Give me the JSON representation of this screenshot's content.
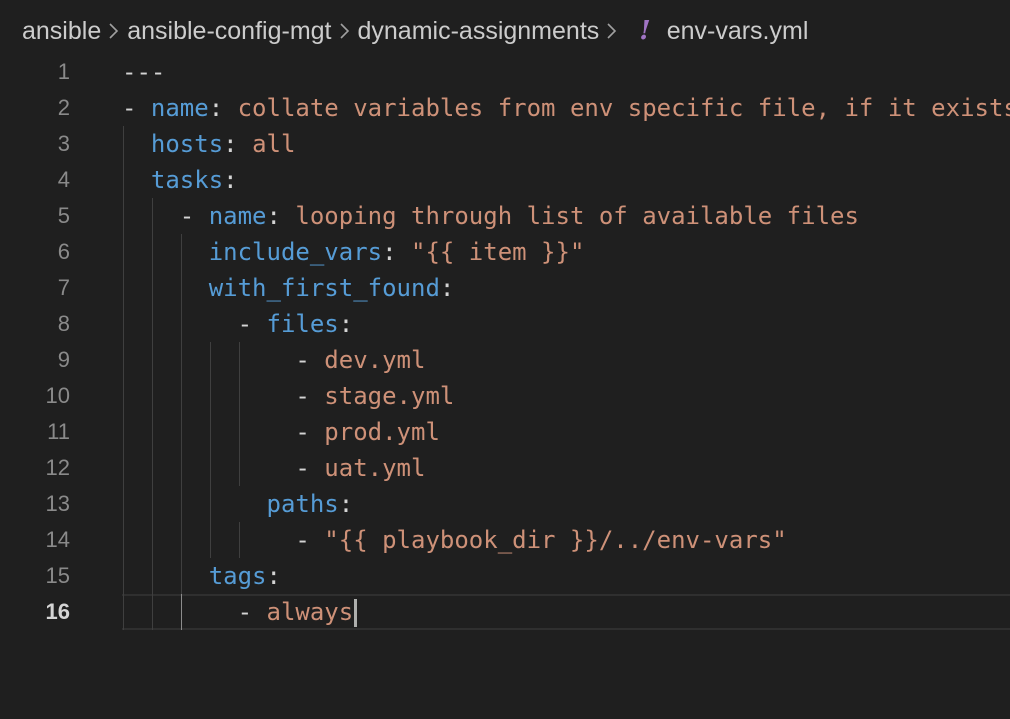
{
  "breadcrumb": {
    "items": [
      "ansible",
      "ansible-config-mgt",
      "dynamic-assignments"
    ],
    "file_icon": "!",
    "file_name": "env-vars.yml",
    "separator_icon": "chevron-right-icon"
  },
  "editor": {
    "current_line": 16,
    "lines": [
      {
        "number": "1",
        "parts": [
          [
            "---",
            "p"
          ]
        ]
      },
      {
        "number": "2",
        "parts": [
          [
            "- ",
            "p"
          ],
          [
            "name",
            "k"
          ],
          [
            ": ",
            "p"
          ],
          [
            "collate variables from env specific file, if it exists",
            "s"
          ]
        ]
      },
      {
        "number": "3",
        "parts": [
          [
            "  ",
            "p"
          ],
          [
            "hosts",
            "k"
          ],
          [
            ": ",
            "p"
          ],
          [
            "all",
            "s"
          ]
        ]
      },
      {
        "number": "4",
        "parts": [
          [
            "  ",
            "p"
          ],
          [
            "tasks",
            "k"
          ],
          [
            ":",
            "p"
          ]
        ]
      },
      {
        "number": "5",
        "parts": [
          [
            "    - ",
            "p"
          ],
          [
            "name",
            "k"
          ],
          [
            ": ",
            "p"
          ],
          [
            "looping through list of available files",
            "s"
          ]
        ]
      },
      {
        "number": "6",
        "parts": [
          [
            "      ",
            "p"
          ],
          [
            "include_vars",
            "k"
          ],
          [
            ": ",
            "p"
          ],
          [
            "\"{{ item }}\"",
            "s"
          ]
        ]
      },
      {
        "number": "7",
        "parts": [
          [
            "      ",
            "p"
          ],
          [
            "with_first_found",
            "k"
          ],
          [
            ":",
            "p"
          ]
        ]
      },
      {
        "number": "8",
        "parts": [
          [
            "        - ",
            "p"
          ],
          [
            "files",
            "k"
          ],
          [
            ":",
            "p"
          ]
        ]
      },
      {
        "number": "9",
        "parts": [
          [
            "            - ",
            "p"
          ],
          [
            "dev.yml",
            "s"
          ]
        ]
      },
      {
        "number": "10",
        "parts": [
          [
            "            - ",
            "p"
          ],
          [
            "stage.yml",
            "s"
          ]
        ]
      },
      {
        "number": "11",
        "parts": [
          [
            "            - ",
            "p"
          ],
          [
            "prod.yml",
            "s"
          ]
        ]
      },
      {
        "number": "12",
        "parts": [
          [
            "            - ",
            "p"
          ],
          [
            "uat.yml",
            "s"
          ]
        ]
      },
      {
        "number": "13",
        "parts": [
          [
            "          ",
            "p"
          ],
          [
            "paths",
            "k"
          ],
          [
            ":",
            "p"
          ]
        ]
      },
      {
        "number": "14",
        "parts": [
          [
            "            - ",
            "p"
          ],
          [
            "\"{{ playbook_dir }}/../env-vars\"",
            "s"
          ]
        ]
      },
      {
        "number": "15",
        "parts": [
          [
            "      ",
            "p"
          ],
          [
            "tags",
            "k"
          ],
          [
            ":",
            "p"
          ]
        ]
      },
      {
        "number": "16",
        "parts": [
          [
            "        - ",
            "p"
          ],
          [
            "always",
            "s"
          ]
        ]
      }
    ]
  },
  "colors": {
    "background": "#1f1f1f",
    "key": "#569cd6",
    "string": "#ce9178",
    "punctuation": "#d4d4d4",
    "line_number": "#8a8a8a",
    "yaml_file_icon": "#a074c4"
  }
}
